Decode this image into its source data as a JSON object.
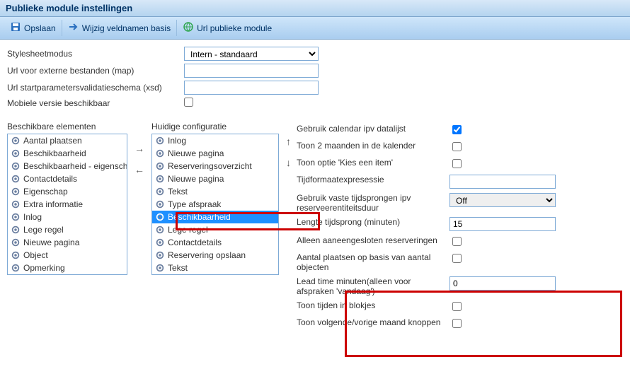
{
  "title": "Publieke module instellingen",
  "toolbar": {
    "save": "Opslaan",
    "edit_fieldnames": "Wijzig veldnamen basis",
    "url_public": "Url publieke module"
  },
  "form": {
    "stylesheet_mode_label": "Stylesheetmodus",
    "stylesheet_mode_value": "Intern - standaard",
    "url_external_label": "Url voor externe bestanden (map)",
    "url_external_value": "",
    "url_startparam_label": "Url startparametersvalidatieschema (xsd)",
    "url_startparam_value": "",
    "mobile_label": "Mobiele versie beschikbaar",
    "mobile_checked": false
  },
  "available": {
    "label": "Beschikbare elementen",
    "items": [
      "Aantal plaatsen",
      "Beschikbaarheid",
      "Beschikbaarheid - eigenschappen",
      "Contactdetails",
      "Eigenschap",
      "Extra informatie",
      "Inlog",
      "Lege regel",
      "Nieuwe pagina",
      "Object",
      "Opmerking"
    ]
  },
  "current": {
    "label": "Huidige configuratie",
    "items": [
      {
        "text": "Inlog",
        "selected": false
      },
      {
        "text": "Nieuwe pagina",
        "selected": false
      },
      {
        "text": "Reserveringsoverzicht",
        "selected": false
      },
      {
        "text": "Nieuwe pagina",
        "selected": false
      },
      {
        "text": "Tekst",
        "selected": false
      },
      {
        "text": "Type afspraak",
        "selected": false
      },
      {
        "text": "Beschikbaarheid",
        "selected": true
      },
      {
        "text": "Lege regel",
        "selected": false
      },
      {
        "text": "Contactdetails",
        "selected": false
      },
      {
        "text": "Reservering opslaan",
        "selected": false
      },
      {
        "text": "Tekst",
        "selected": false
      }
    ]
  },
  "settings": {
    "use_calendar_label": "Gebruik calendar ipv datalijst",
    "use_calendar_checked": true,
    "show_two_months_label": "Toon 2 maanden in de kalender",
    "show_two_months_checked": false,
    "show_kies_label": "Toon optie 'Kies een item'",
    "show_kies_checked": false,
    "tijdformaat_label": "Tijdformaatexpresessie",
    "tijdformaat_value": "",
    "vaste_tijd_label": "Gebruik vaste tijdsprongen ipv reserveerentiteitsduur",
    "vaste_tijd_value": "Off",
    "lengte_label": "Lengte tijdsprong (minuten)",
    "lengte_value": "15",
    "aaneen_label": "Alleen aaneengesloten reserveringen",
    "aaneen_checked": false,
    "aantal_plaatsen_label": "Aantal plaatsen op basis van aantal objecten",
    "aantal_plaatsen_checked": false,
    "lead_time_label": "Lead time minuten(alleen voor afspraken 'vandaag')",
    "lead_time_value": "0",
    "toon_tijden_label": "Toon tijden in blokjes",
    "toon_tijden_checked": false,
    "toon_volgende_label": "Toon volgende/vorige maand knoppen",
    "toon_volgende_checked": false
  }
}
